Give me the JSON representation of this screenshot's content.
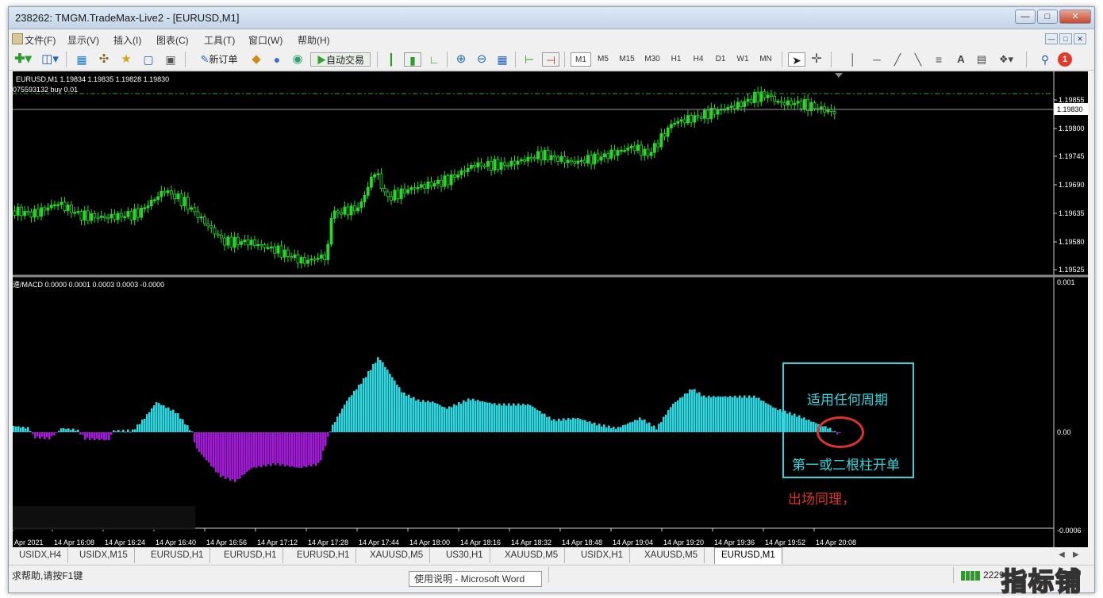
{
  "window": {
    "title": "238262: TMGM.TradeMax-Live2 - [EURUSD,M1]"
  },
  "menu": [
    "文件(F)",
    "显示(V)",
    "插入(I)",
    "图表(C)",
    "工具(T)",
    "窗口(W)",
    "帮助(H)"
  ],
  "toolbar": {
    "new_order": "新订单",
    "auto_trade": "自动交易",
    "timeframes": [
      "M1",
      "M5",
      "M15",
      "M30",
      "H1",
      "H4",
      "D1",
      "W1",
      "MN"
    ],
    "text_tool": "A",
    "notification_count": "1"
  },
  "chart": {
    "header": "EURUSD,M1  1.19834 1.19835 1.19828 1.19830",
    "order_line": "075593132 buy 0.01",
    "price_labels": [
      "1.19855",
      "1.19800",
      "1.19745",
      "1.19690",
      "1.19635",
      "1.19580",
      "1.19525"
    ],
    "current_price": "1.19830",
    "macd_header": "速/MACD 0.0000 0.0001 0.0003 0.0003 -0.0000",
    "macd_labels": [
      "0.001",
      "0.00",
      "-0.0006"
    ],
    "time_labels": [
      "Apr 2021",
      "14 Apr 16:08",
      "14 Apr 16:24",
      "14 Apr 16:40",
      "14 Apr 16:56",
      "14 Apr 17:12",
      "14 Apr 17:28",
      "14 Apr 17:44",
      "14 Apr 18:00",
      "14 Apr 18:16",
      "14 Apr 18:32",
      "14 Apr 18:48",
      "14 Apr 19:04",
      "14 Apr 19:20",
      "14 Apr 19:36",
      "14 Apr 19:52",
      "14 Apr 20:08"
    ],
    "colors": {
      "candles": "#26d926",
      "macd_positive": "#2fd7e0",
      "macd_negative": "#a21bd6",
      "order_line": "#1fae1f"
    }
  },
  "annotations": {
    "any_period": "适用任何周期",
    "open_order": "第一或二根柱开单",
    "exit_same": "出场同理，"
  },
  "tabs": [
    "USIDX,H4",
    "USIDX,M15",
    "EURUSD,H1",
    "EURUSD,H1",
    "EURUSD,H1",
    "XAUUSD,M5",
    "US30,H1",
    "XAUUSD,M5",
    "USIDX,H1",
    "XAUUSD,M5",
    "EURUSD,M1"
  ],
  "active_tab": "EURUSD,M1",
  "statusbar": {
    "help": "求帮助,请按F1键",
    "taskbar_popup": "使用说明 - Microsoft Word",
    "connection": "2229"
  },
  "watermark": "指标铺"
}
